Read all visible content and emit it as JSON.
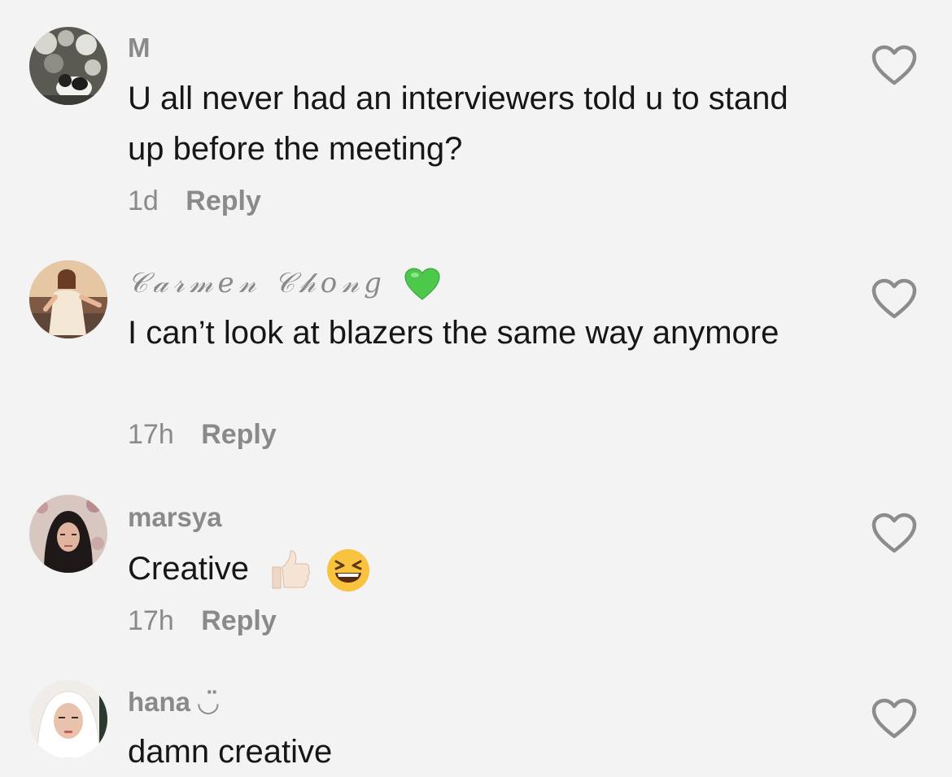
{
  "comments": [
    {
      "username": "M",
      "text": "U all never had an interviewers told u to stand up before the meeting?",
      "time": "1d",
      "reply_label": "Reply",
      "avatar_icon": "avatar-photo-cat"
    },
    {
      "username": "𝒞𝒶𝓇𝓂𝑒𝓃 𝒞𝒽𝑜𝓃𝑔",
      "username_suffix_icon": "green-heart-icon",
      "text": "I can’t look at blazers the same way anymore",
      "time": "17h",
      "reply_label": "Reply",
      "avatar_icon": "avatar-photo-woman-sunset"
    },
    {
      "username": "marsya",
      "text": "Creative",
      "text_emojis": [
        "thumbs-up-icon",
        "grinning-squinting-face-icon"
      ],
      "time": "17h",
      "reply_label": "Reply",
      "avatar_icon": "avatar-photo-hijab"
    },
    {
      "username": "hana ◡̈",
      "text": "damn creative",
      "avatar_icon": "avatar-photo-hana"
    }
  ],
  "like_icon": "heart-outline-icon",
  "colors": {
    "background": "#f3f3f3",
    "text": "#161616",
    "secondary": "#8a8a8a",
    "green_heart": "#4cc94a"
  }
}
